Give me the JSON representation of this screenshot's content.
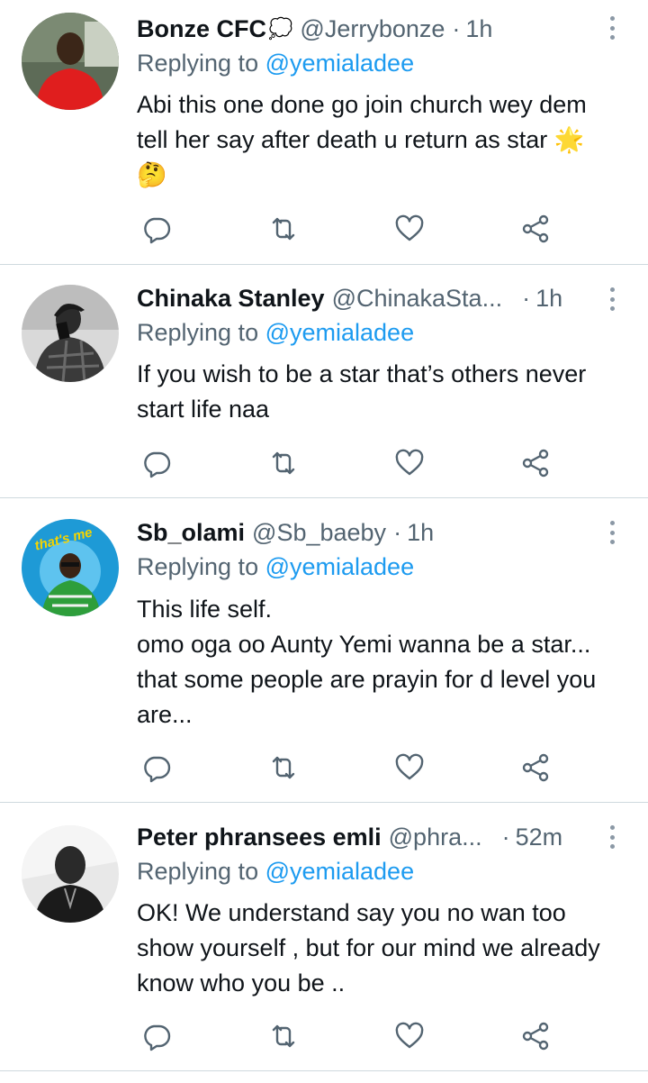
{
  "colors": {
    "link": "#1d9bf0",
    "secondary": "#536471",
    "icon": "#536471",
    "divider": "#cfd9de"
  },
  "tweets": [
    {
      "name": "Bonze CFC",
      "badge": "💭",
      "handle": "@Jerrybonze",
      "sep": "·",
      "time": "1h",
      "replying_prefix": "Replying to ",
      "replying_handle": "@yemialadee",
      "text": "Abi this one done go join church wey dem tell her  say after death u return as star 🌟🤔",
      "icons": [
        "reply-icon",
        "retweet-icon",
        "like-icon",
        "share-icon"
      ]
    },
    {
      "name": "Chinaka Stanley",
      "handle": "@ChinakaSta...",
      "sep": "·",
      "time": "1h",
      "replying_prefix": "Replying to ",
      "replying_handle": "@yemialadee",
      "text": "If you wish to be a star that’s others never start life naa",
      "icons": [
        "reply-icon",
        "retweet-icon",
        "like-icon",
        "share-icon"
      ]
    },
    {
      "name": "Sb_olami",
      "handle": "@Sb_baeby",
      "sep": "·",
      "time": "1h",
      "replying_prefix": "Replying to ",
      "replying_handle": "@yemialadee",
      "text": "This life self.\nomo oga oo Aunty Yemi wanna be a star... that some people are prayin for d level you are...",
      "avatar_caption": "that's me",
      "icons": [
        "reply-icon",
        "retweet-icon",
        "like-icon",
        "share-icon"
      ]
    },
    {
      "name": "Peter phransees emli",
      "handle": "@phra...",
      "sep": "·",
      "time": "52m",
      "replying_prefix": "Replying to ",
      "replying_handle": "@yemialadee",
      "text": "OK! We understand say you no wan too show yourself , but for our mind we already know who you  be ..",
      "icons": [
        "reply-icon",
        "retweet-icon",
        "like-icon",
        "share-icon"
      ]
    }
  ]
}
